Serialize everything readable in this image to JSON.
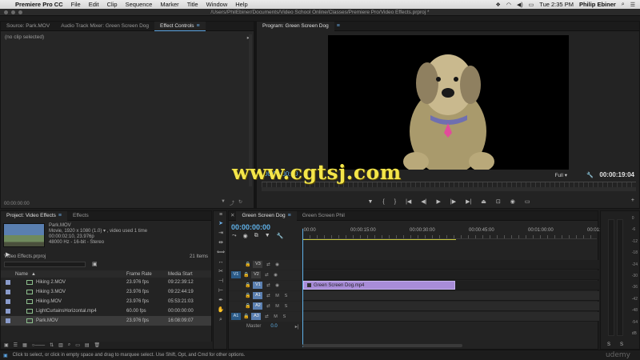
{
  "menubar": {
    "app": "Premiere Pro CC",
    "items": [
      "File",
      "Edit",
      "Clip",
      "Sequence",
      "Marker",
      "Title",
      "Window",
      "Help"
    ],
    "time": "Tue 2:35 PM",
    "user": "Philip Ebiner"
  },
  "window": {
    "title": "/Users/PhilEbiner/Documents/Video School Online/Classes/Premiere Pro/Video Effects.prproj *"
  },
  "source_panel": {
    "tabs": [
      "Source: Park.MOV",
      "Audio Track Mixer: Green Screen Dog",
      "Effect Controls"
    ],
    "active_tab": "Effect Controls",
    "message": "(no clip selected)",
    "timecode": "00:00:00:00"
  },
  "program_panel": {
    "tab": "Program: Green Screen Dog",
    "fit": "Full",
    "timecode": "00:00:19:04"
  },
  "project_panel": {
    "tabs": [
      "Project: Video Effects",
      "Effects"
    ],
    "clip_name": "Park.MOV",
    "clip_info_1": "Movie, 1920 x 1080 (1.0) ▾ , video used 1 time",
    "clip_info_2": "00:00:02:10, 23.976p",
    "clip_info_3": "48000 Hz - 16-bit - Stereo",
    "project_file": "Video Effects.prproj",
    "item_count": "21 Items",
    "columns": [
      "Name",
      "Frame Rate",
      "Media Start"
    ],
    "rows": [
      {
        "name": "Hiking 2.MOV",
        "rate": "23.976 fps",
        "start": "09:22:39:12"
      },
      {
        "name": "Hiking 3.MOV",
        "rate": "23.976 fps",
        "start": "09:22:44:19"
      },
      {
        "name": "Hiking.MOV",
        "rate": "23.976 fps",
        "start": "05:53:21:03"
      },
      {
        "name": "LightCurtainsHorizontal.mp4",
        "rate": "60.00 fps",
        "start": "00:00:00:00"
      },
      {
        "name": "Park.MOV",
        "rate": "23.976 fps",
        "start": "16:08:09:07"
      }
    ]
  },
  "timeline_panel": {
    "tabs": [
      "Green Screen Dog",
      "Green Screen Phil"
    ],
    "timecode": "00:00:00:00",
    "ruler": [
      ":00:00",
      "00:00:15:00",
      "00:00:30:00",
      "00:00:45:00",
      "00:01:00:00",
      "00:01:15:00",
      "00:"
    ],
    "video_tracks": [
      "V3",
      "V2",
      "V1"
    ],
    "audio_tracks": [
      "A1",
      "A2",
      "A3"
    ],
    "master_label": "Master",
    "master_value": "0.0",
    "clip_label": "Green Screen Dog.mp4"
  },
  "meters": {
    "scale": [
      "0",
      "-6",
      "-12",
      "-18",
      "-24",
      "-30",
      "-36",
      "-42",
      "-48",
      "-54",
      "dB"
    ],
    "solo_left": "S",
    "solo_right": "S"
  },
  "statusbar": {
    "text": "Click to select, or click in empty space and drag to marquee select. Use Shift, Opt, and Cmd for other options."
  },
  "overlay": {
    "watermark": "www.cgtsj.com",
    "brand": "udemy"
  }
}
